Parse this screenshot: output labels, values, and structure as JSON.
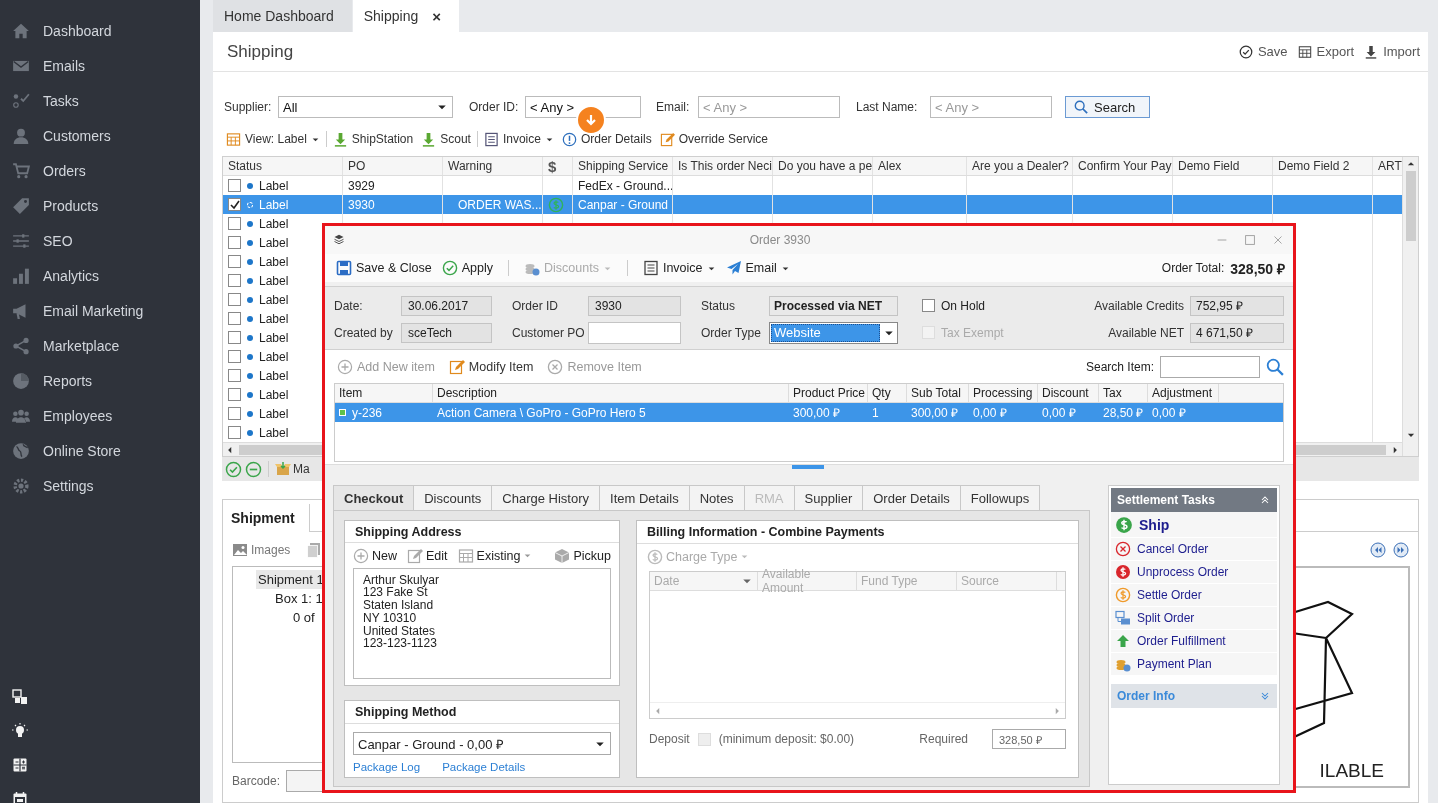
{
  "sidebar": {
    "items": [
      {
        "label": "Dashboard"
      },
      {
        "label": "Emails"
      },
      {
        "label": "Tasks"
      },
      {
        "label": "Customers"
      },
      {
        "label": "Orders"
      },
      {
        "label": "Products"
      },
      {
        "label": "SEO"
      },
      {
        "label": "Analytics"
      },
      {
        "label": "Email Marketing"
      },
      {
        "label": "Marketplace"
      },
      {
        "label": "Reports"
      },
      {
        "label": "Employees"
      },
      {
        "label": "Online Store"
      },
      {
        "label": "Settings"
      }
    ]
  },
  "tabs": [
    {
      "label": "Home Dashboard",
      "selected": false
    },
    {
      "label": "Shipping",
      "selected": true,
      "close": "×"
    }
  ],
  "page": {
    "title": "Shipping",
    "actions": [
      {
        "label": "Save"
      },
      {
        "label": "Export"
      },
      {
        "label": "Import"
      }
    ]
  },
  "filters": [
    {
      "kind": "dropdown",
      "label": "Supplier:",
      "value": "All"
    },
    {
      "kind": "text",
      "label": "Order ID:",
      "value": "< Any >"
    },
    {
      "kind": "text",
      "label": "Email:",
      "placeholder": "< Any >"
    },
    {
      "kind": "text",
      "label": "Last Name:",
      "placeholder": "< Any >"
    }
  ],
  "search_button": "Search",
  "toolbar": [
    {
      "label": "View: Label",
      "menu": true
    },
    {
      "label": "ShipStation",
      "menu": false
    },
    {
      "label": "Scout",
      "menu": false
    },
    {
      "label": "Invoice",
      "menu": true
    },
    {
      "label": "Order Details",
      "menu": false
    },
    {
      "label": "Override Service",
      "menu": false
    }
  ],
  "grid": {
    "columns": [
      "Status",
      "PO",
      "Warning",
      "$",
      "Shipping Service",
      "Is This order Neci",
      "Do you have a pe",
      "Alex",
      "Are you a Dealer?",
      "Confirm Your Pay",
      "Demo Field",
      "Demo Field 2",
      "ART"
    ],
    "rows": [
      {
        "selected": false,
        "checked": false,
        "status": "Label",
        "po": "3929",
        "shipping_service": "FedEx - Ground..."
      },
      {
        "selected": true,
        "checked": true,
        "status": "Label",
        "po": "3930",
        "warning": "ORDER WAS...",
        "paid": true,
        "shipping_service": "Canpar - Ground"
      },
      {
        "selected": false,
        "checked": false,
        "status": "Label"
      },
      {
        "selected": false,
        "checked": false,
        "status": "Label"
      },
      {
        "selected": false,
        "checked": false,
        "status": "Label"
      },
      {
        "selected": false,
        "checked": false,
        "status": "Label"
      },
      {
        "selected": false,
        "checked": false,
        "status": "Label"
      },
      {
        "selected": false,
        "checked": false,
        "status": "Label"
      },
      {
        "selected": false,
        "checked": false,
        "status": "Label"
      },
      {
        "selected": false,
        "checked": false,
        "status": "Label"
      },
      {
        "selected": false,
        "checked": false,
        "status": "Label"
      },
      {
        "selected": false,
        "checked": false,
        "status": "Label"
      },
      {
        "selected": false,
        "checked": false,
        "status": "Label"
      },
      {
        "selected": false,
        "checked": false,
        "status": "Label"
      }
    ]
  },
  "grid_footer": {
    "text": "Ma"
  },
  "shipment": {
    "tab": "Shipment",
    "tool": "Images",
    "tree": [
      "Shipment 1",
      "Box 1: 1",
      "0 of"
    ],
    "barcode_label": "Barcode:",
    "image_caption": "ILABLE"
  },
  "dialog": {
    "title": "Order 3930",
    "toolbar": [
      {
        "label": "Save & Close",
        "disabled": false,
        "menu": false
      },
      {
        "label": "Apply",
        "disabled": false,
        "menu": false
      },
      {
        "label": "Discounts",
        "disabled": true,
        "menu": true
      },
      {
        "label": "Invoice",
        "disabled": false,
        "menu": true
      },
      {
        "label": "Email",
        "disabled": false,
        "menu": true
      }
    ],
    "total_label": "Order Total:",
    "total": "328,50 ₽",
    "fields": [
      {
        "kind": "readonly",
        "label": "Date:",
        "value": "30.06.2017"
      },
      {
        "kind": "readonly",
        "label": "Order ID",
        "value": "3930"
      },
      {
        "kind": "status",
        "label": "Status",
        "value": "Processed via NET"
      },
      {
        "kind": "checkbox",
        "label": "On Hold",
        "checked": false,
        "disabled": false
      },
      {
        "kind": "amount",
        "label": "Available Credits",
        "value": "752,95 ₽"
      },
      {
        "kind": "readonly",
        "label": "Created by",
        "value": "sceTech"
      },
      {
        "kind": "input",
        "label": "Customer PO"
      },
      {
        "kind": "dropdown",
        "label": "Order Type",
        "value": "Website"
      },
      {
        "kind": "checkbox",
        "label": "Tax Exempt",
        "checked": false,
        "disabled": true
      },
      {
        "kind": "amount",
        "label": "Available NET",
        "value": "4 671,50 ₽"
      }
    ],
    "item_tools": [
      {
        "label": "Add New item",
        "disabled": true
      },
      {
        "label": "Modify Item",
        "disabled": false
      },
      {
        "label": "Remove Item",
        "disabled": true
      }
    ],
    "search_label": "Search Item:",
    "items": {
      "columns": [
        "Item",
        "Description",
        "Product Price",
        "Qty",
        "Sub Total",
        "Processing",
        "Discount",
        "Tax",
        "Adjustment"
      ],
      "rows": [
        {
          "selected": true,
          "cells": [
            "y-236",
            "Action Camera \\ GoPro - GoPro Hero 5",
            "300,00 ₽",
            "1",
            "300,00 ₽",
            "0,00 ₽",
            "0,00 ₽",
            "28,50 ₽",
            "0,00 ₽"
          ]
        }
      ]
    },
    "tabs": [
      {
        "label": "Checkout",
        "selected": true,
        "disabled": false
      },
      {
        "label": "Discounts",
        "selected": false,
        "disabled": false
      },
      {
        "label": "Charge History",
        "selected": false,
        "disabled": false
      },
      {
        "label": "Item Details",
        "selected": false,
        "disabled": false
      },
      {
        "label": "Notes",
        "selected": false,
        "disabled": false
      },
      {
        "label": "RMA",
        "selected": false,
        "disabled": true
      },
      {
        "label": "Supplier",
        "selected": false,
        "disabled": false
      },
      {
        "label": "Order Details",
        "selected": false,
        "disabled": false
      },
      {
        "label": "Followups",
        "selected": false,
        "disabled": false
      }
    ],
    "shipping_address": {
      "title": "Shipping Address",
      "tools": [
        {
          "label": "New",
          "menu": false,
          "disabled": false
        },
        {
          "label": "Edit",
          "menu": false,
          "disabled": false
        },
        {
          "label": "Existing",
          "menu": true,
          "disabled": false
        },
        {
          "label": "Pickup",
          "menu": false,
          "disabled": false
        }
      ],
      "lines": [
        "Arthur Skulyar",
        "123 Fake St",
        "Staten Island",
        "NY 10310",
        "United States",
        "123-123-1123"
      ]
    },
    "shipping_method": {
      "title": "Shipping Method",
      "value": "Canpar - Ground - 0,00 ₽",
      "links": [
        "Package Log",
        "Package Details"
      ]
    },
    "billing": {
      "title": "Billing Information - Combine Payments",
      "charge_type": "Charge Type",
      "columns": [
        "Date",
        "Available Amount",
        "Fund Type",
        "Source"
      ],
      "deposit_label": "Deposit",
      "deposit_checked": false,
      "deposit_note": "(minimum deposit: $0.00)",
      "required_label": "Required",
      "required": "328,50 ₽"
    },
    "settlement": {
      "title": "Settlement Tasks",
      "expanded": true,
      "tasks": [
        {
          "label": "Ship",
          "kind": "primary"
        },
        {
          "label": "Cancel Order",
          "kind": "task"
        },
        {
          "label": "Unprocess Order",
          "kind": "task"
        },
        {
          "label": "Settle Order",
          "kind": "task"
        },
        {
          "label": "Split Order",
          "kind": "task"
        },
        {
          "label": "Order Fulfillment",
          "kind": "task"
        },
        {
          "label": "Payment Plan",
          "kind": "task"
        }
      ],
      "sections": [
        {
          "label": "Order Info",
          "expanded": false
        }
      ]
    }
  }
}
